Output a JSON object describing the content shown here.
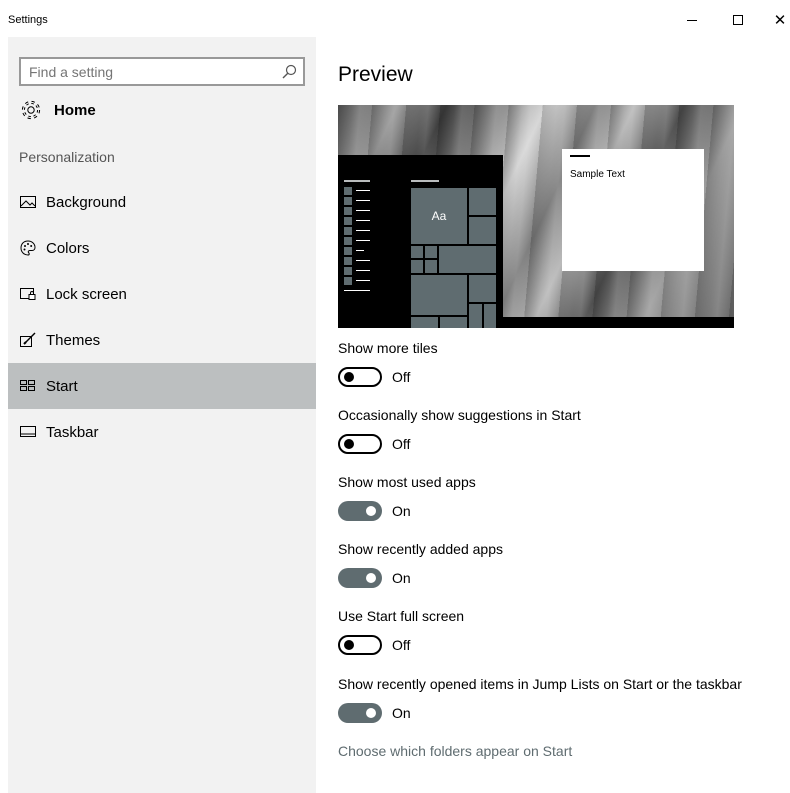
{
  "window": {
    "title": "Settings",
    "minimize_icon": "minimize-icon",
    "maximize_icon": "maximize-icon",
    "close_icon": "close-icon",
    "close_glyph": "✕"
  },
  "sidebar": {
    "search_placeholder": "Find a setting",
    "search_icon": "search-icon",
    "home_label": "Home",
    "home_icon": "gear-icon",
    "section_label": "Personalization",
    "items": [
      {
        "label": "Background",
        "icon": "background-image-icon",
        "selected": false
      },
      {
        "label": "Colors",
        "icon": "palette-icon",
        "selected": false
      },
      {
        "label": "Lock screen",
        "icon": "lock-screen-icon",
        "selected": false
      },
      {
        "label": "Themes",
        "icon": "themes-icon",
        "selected": false
      },
      {
        "label": "Start",
        "icon": "start-menu-icon",
        "selected": true
      },
      {
        "label": "Taskbar",
        "icon": "taskbar-icon",
        "selected": false
      }
    ],
    "selected_bg": "#bcbfc0"
  },
  "main": {
    "preview_title": "Preview",
    "preview": {
      "tile_text": "Aa",
      "sample_text": "Sample Text"
    },
    "settings": [
      {
        "label": "Show more tiles",
        "state": "Off",
        "on": false
      },
      {
        "label": "Occasionally show suggestions in Start",
        "state": "Off",
        "on": false
      },
      {
        "label": "Show most used apps",
        "state": "On",
        "on": true
      },
      {
        "label": "Show recently added apps",
        "state": "On",
        "on": true
      },
      {
        "label": "Use Start full screen",
        "state": "Off",
        "on": false
      },
      {
        "label": "Show recently opened items in Jump Lists on Start or the taskbar",
        "state": "On",
        "on": true
      }
    ],
    "folders_link": "Choose which folders appear on Start",
    "accent_color": "#5f6c70"
  }
}
